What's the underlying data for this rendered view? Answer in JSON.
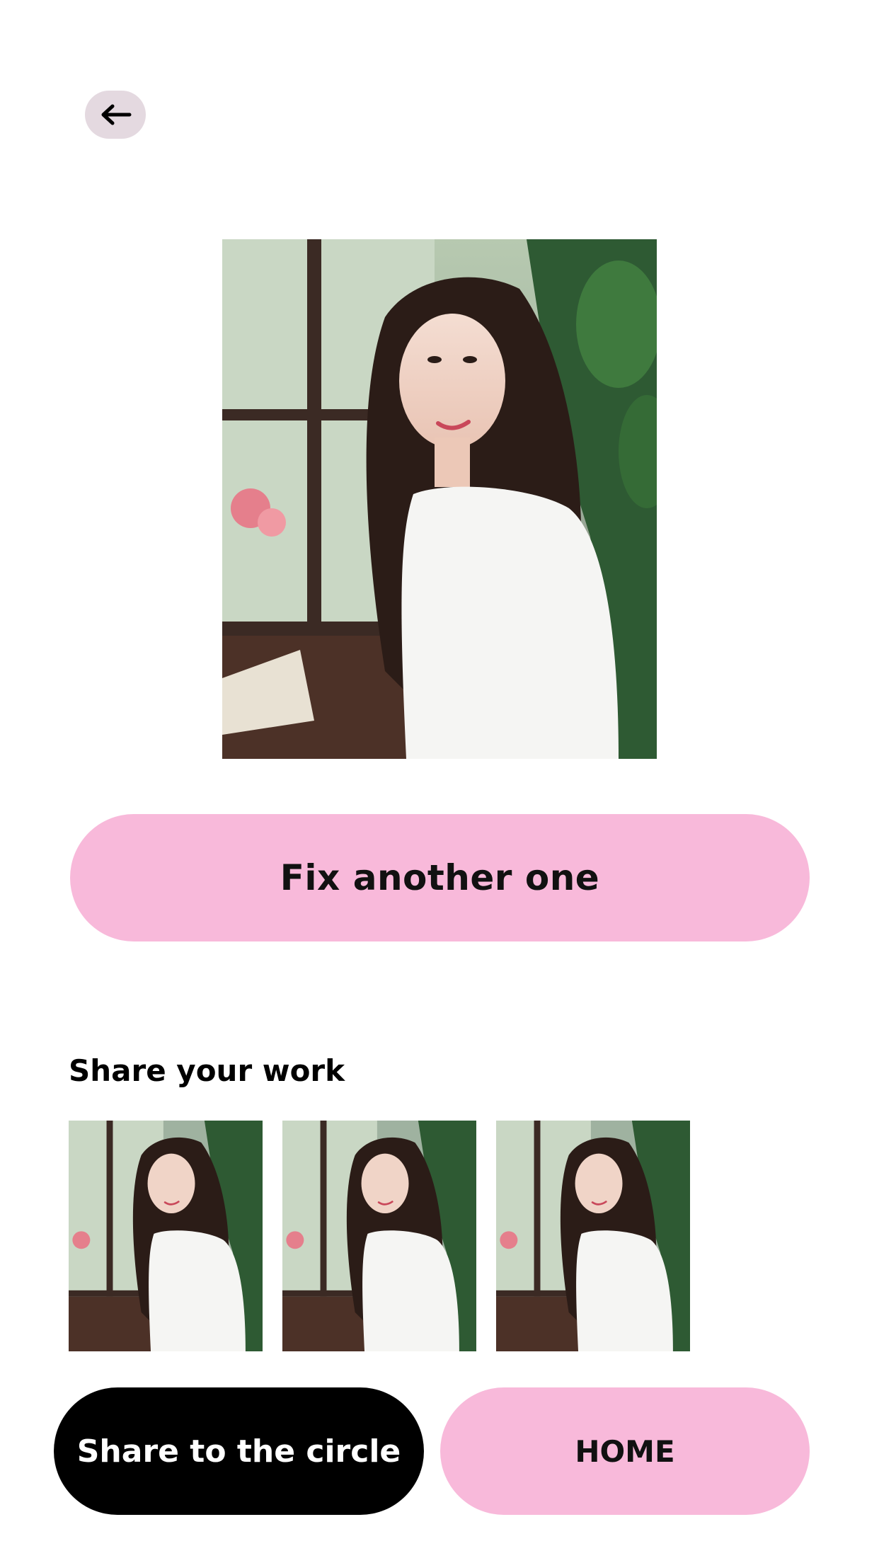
{
  "header": {
    "back_icon": "arrow-left-icon"
  },
  "main": {
    "photo_alt": "Portrait photo"
  },
  "actions": {
    "fix_label": "Fix another one"
  },
  "share": {
    "title": "Share your work",
    "thumb_count": 3
  },
  "footer": {
    "share_label": "Share to the circle",
    "home_label": "HOME"
  },
  "colors": {
    "pink": "#f8b9da",
    "back_bg": "#e4d9e0",
    "dark": "#000000"
  }
}
